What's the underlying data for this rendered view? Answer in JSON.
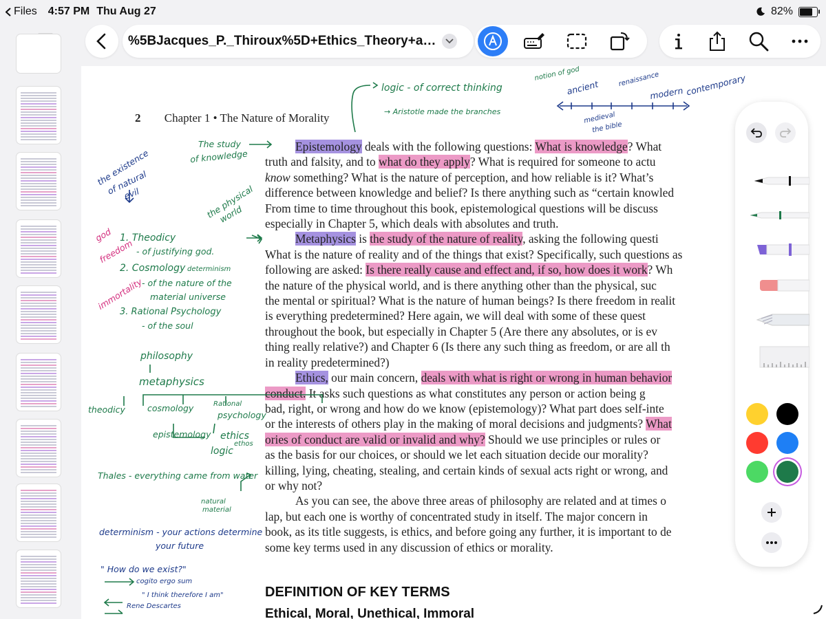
{
  "status_bar": {
    "back_app": "Files",
    "time": "4:57 PM",
    "date": "Thu Aug 27",
    "battery": "82%",
    "battery_level": 0.82
  },
  "toolbar": {
    "document_title": "%5BJacques_P._Thiroux%5D+Ethics_Theory+an...",
    "icons": [
      "back-chevron-icon",
      "chevron-down-icon",
      "markup-pen-icon",
      "keyboard-pen-icon",
      "selection-icon",
      "rotate-icon",
      "info-icon",
      "share-icon",
      "search-icon",
      "more-icon"
    ]
  },
  "document": {
    "page_number": "2",
    "running_head": "Chapter 1 • The Nature of Morality",
    "lines": [
      {
        "parts": [
          {
            "t": "Epistemology",
            "h": "p"
          },
          {
            "t": " deals with the following questions: "
          },
          {
            "t": "What is knowledge",
            "h": "m"
          },
          {
            "t": "? What"
          }
        ],
        "indent": true
      },
      {
        "parts": [
          {
            "t": "truth and falsity, and to "
          },
          {
            "t": "what do they apply",
            "h": "m"
          },
          {
            "t": "? What is required for someone to actu"
          }
        ]
      },
      {
        "parts": [
          {
            "t": "know",
            "i": true
          },
          {
            "t": " something? What is the nature of perception, and how reliable is it? What’s"
          }
        ]
      },
      {
        "parts": [
          {
            "t": "difference between knowledge and belief? Is there anything such as “certain knowled"
          }
        ]
      },
      {
        "parts": [
          {
            "t": "From time to time throughout this book, epistemological questions will be discuss"
          }
        ]
      },
      {
        "parts": [
          {
            "t": "especially in Chapter 5, which deals with absolutes and truth."
          }
        ]
      },
      {
        "parts": [
          {
            "t": "Metaphysics",
            "h": "p"
          },
          {
            "t": " is "
          },
          {
            "t": "the study of the nature of reality",
            "h": "m"
          },
          {
            "t": ", asking the following questi"
          }
        ],
        "indent": true
      },
      {
        "parts": [
          {
            "t": "What is the nature of reality and of the things that exist? Specifically, such questions as"
          }
        ]
      },
      {
        "parts": [
          {
            "t": "following are asked: "
          },
          {
            "t": "Is there really cause and effect and, if so, how does it work",
            "h": "m"
          },
          {
            "t": "? Wh"
          }
        ]
      },
      {
        "parts": [
          {
            "t": "the nature of the physical world, and is there anything other than the physical, suc"
          }
        ]
      },
      {
        "parts": [
          {
            "t": "the mental or spiritual? What is the nature of human beings? Is there freedom in realit"
          }
        ]
      },
      {
        "parts": [
          {
            "t": "is everything predetermined? Here again, we will deal with some of these quest"
          }
        ]
      },
      {
        "parts": [
          {
            "t": "throughout the book, but especially in Chapter 5 (Are there any absolutes, or is ev"
          }
        ]
      },
      {
        "parts": [
          {
            "t": "thing really relative?) and Chapter 6 (Is there any such thing as freedom, or are all th"
          }
        ]
      },
      {
        "parts": [
          {
            "t": "in reality predetermined?)"
          }
        ]
      },
      {
        "parts": [
          {
            "t": "Ethics,",
            "h": "p"
          },
          {
            "t": " our main concern, "
          },
          {
            "t": "deals with what is right or wrong in human behavior",
            "h": "m"
          }
        ],
        "indent": true
      },
      {
        "parts": [
          {
            "t": "conduct.",
            "h": "m"
          },
          {
            "t": " It asks such questions as what constitutes any person or action being g"
          }
        ]
      },
      {
        "parts": [
          {
            "t": "bad, right, or wrong and how do we know (epistemology)? What part does self-inte"
          }
        ]
      },
      {
        "parts": [
          {
            "t": "or the interests of others play in the making of moral decisions and judgments? "
          },
          {
            "t": "What",
            "h": "m"
          }
        ]
      },
      {
        "parts": [
          {
            "t": "ories of conduct are valid or invalid and why?",
            "h": "m"
          },
          {
            "t": " Should we use principles or rules or"
          }
        ]
      },
      {
        "parts": [
          {
            "t": "as the basis for our choices, or should we let each situation decide our morality?"
          }
        ]
      },
      {
        "parts": [
          {
            "t": "killing, lying, cheating, stealing, and certain kinds of sexual acts right or wrong, and"
          }
        ]
      },
      {
        "parts": [
          {
            "t": "or why not?"
          }
        ]
      },
      {
        "parts": [
          {
            "t": "As you can see, the above three areas of philosophy are related and at times o"
          }
        ],
        "indent": true
      },
      {
        "parts": [
          {
            "t": "lap, but each one is worthy of concentrated study in itself. The major concern in"
          }
        ]
      },
      {
        "parts": [
          {
            "t": "book, as its title suggests, is ethics, and before going any further, it is important to de"
          }
        ]
      },
      {
        "parts": [
          {
            "t": "some key terms used in any discussion of ethics or morality."
          }
        ]
      }
    ],
    "section_heading": "DEFINITION OF KEY TERMS",
    "subsection_heading": "Ethical, Moral, Unethical, Immoral"
  },
  "annotations": {
    "logic_note": "logic - of correct thinking",
    "aristotle_note": "→ Aristotle made the branches",
    "timeline_notion": "notion of god",
    "timeline_ancient": "ancient",
    "timeline_renaissance": "renaissance",
    "timeline_modern": "modern",
    "timeline_contemporary": "contemporary",
    "timeline_medieval": "medieval",
    "timeline_bible": "the bible",
    "study_knowledge_1": "The study",
    "study_knowledge_2": "of knowledge",
    "natural_evil_1": "the existence",
    "natural_evil_2": "of natural",
    "natural_evil_3": "evil",
    "physical_world_1": "the physical",
    "physical_world_2": "world",
    "god": "god",
    "freedom": "freedom",
    "immortality": "immortality",
    "theodicy": "1. Theodicy",
    "theodicy_def": "- of justifying god.",
    "cosmology": "2. Cosmology",
    "determinism_small": "determinism",
    "cosmology_def_1": "- of the nature of the",
    "cosmology_def_2": "material universe",
    "psych": "3. Rational Psychology",
    "psych_def": "- of the soul",
    "tree_philosophy": "philosophy",
    "tree_metaphysics": "metaphysics",
    "tree_theodicy": "theodicy",
    "tree_cosmology": "cosmology",
    "tree_rational_1": "Rational",
    "tree_rational_2": "psychology",
    "tree_epistemology": "epistemology",
    "tree_ethics": "ethics",
    "tree_ethos": "ethos",
    "tree_logic": "logic",
    "thales": "Thales - everything came from water",
    "natural_material_1": "natural",
    "natural_material_2": "material",
    "determinism_1": "determinism - your actions determine",
    "determinism_2": "your future",
    "how_exist": "\" How do we exist?\"",
    "cogito": "cogito ergo sum",
    "think_therefore": "\" I think therefore I am\"",
    "descartes": "Rene Descartes"
  },
  "palette": {
    "colors": [
      "#ffd12e",
      "#000000",
      "#ff3b30",
      "#1e7ff5",
      "#4cd964",
      "#1e7a4a"
    ],
    "icons": [
      "undo-icon",
      "redo-icon",
      "pen-tool-icon",
      "fineliner-tool-icon",
      "highlighter-tool-icon",
      "eraser-tool-icon",
      "pencil-tool-icon",
      "ruler-tool-icon",
      "plus-icon",
      "more-icon"
    ]
  }
}
